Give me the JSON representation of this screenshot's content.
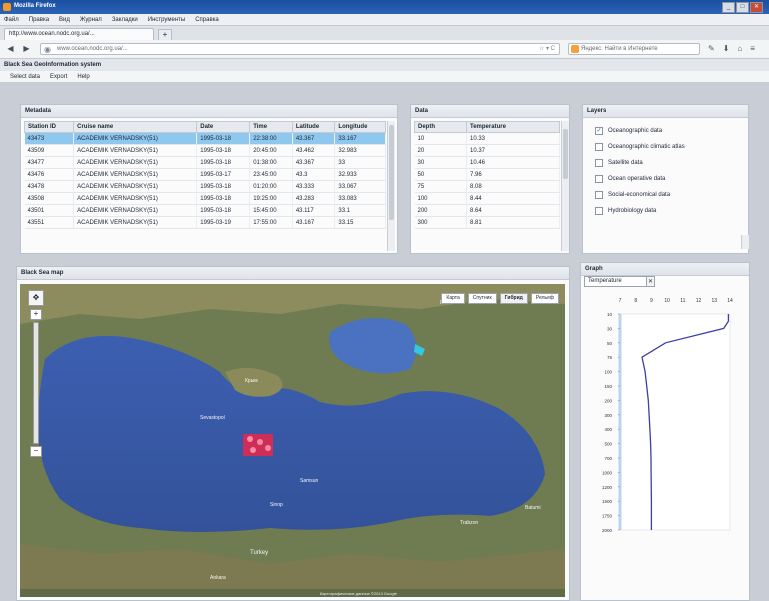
{
  "window": {
    "title": "Mozilla Firefox",
    "minimize": "_",
    "maximize": "□",
    "close": "✕"
  },
  "browser_menu": [
    "Файл",
    "Правка",
    "Вид",
    "Журнал",
    "Закладки",
    "Инструменты",
    "Справка"
  ],
  "tab": {
    "label": "http://www.ocean.nodc.org.ua/...",
    "new_tab": "+"
  },
  "nav": {
    "back": "◀",
    "forward": "▶",
    "url": "www.ocean.nodc.org.ua/...",
    "url_actions": "☆ ▾ C",
    "search_placeholder": "Яндекс: Найти в Интернете",
    "icons": [
      "pencil-icon",
      "download-icon",
      "home-icon",
      "extensions-icon"
    ]
  },
  "app": {
    "title": "Black Sea GeoInformation system",
    "menu": [
      "Select data",
      "Export",
      "Help"
    ]
  },
  "metadata": {
    "header": "Metadata",
    "columns": [
      "Station ID",
      "Cruise name",
      "Date",
      "Time",
      "Latitude",
      "Longitude"
    ],
    "rows": [
      [
        "43473",
        "ACADEMIK VERNADSKY(51)",
        "1995-03-18",
        "22:38:00",
        "43.367",
        "33.167"
      ],
      [
        "43509",
        "ACADEMIK VERNADSKY(51)",
        "1995-03-18",
        "20:45:00",
        "43.462",
        "32.983"
      ],
      [
        "43477",
        "ACADEMIK VERNADSKY(51)",
        "1995-03-18",
        "01:38:00",
        "43.367",
        "33"
      ],
      [
        "43476",
        "ACADEMIK VERNADSKY(51)",
        "1995-03-17",
        "23:45:00",
        "43.3",
        "32.933"
      ],
      [
        "43478",
        "ACADEMIK VERNADSKY(51)",
        "1995-03-18",
        "01:20:00",
        "43.333",
        "33.067"
      ],
      [
        "43508",
        "ACADEMIK VERNADSKY(51)",
        "1995-03-18",
        "19:25:00",
        "43.283",
        "33.083"
      ],
      [
        "43501",
        "ACADEMIK VERNADSKY(51)",
        "1995-03-18",
        "15:45:00",
        "43.117",
        "33.1"
      ],
      [
        "43551",
        "ACADEMIK VERNADSKY(51)",
        "1995-03-19",
        "17:55:00",
        "43.167",
        "33.15"
      ]
    ],
    "selected_row": 0
  },
  "data": {
    "header": "Data",
    "columns": [
      "Depth",
      "Temperature"
    ],
    "rows": [
      [
        "10",
        "10.33"
      ],
      [
        "20",
        "10.37"
      ],
      [
        "30",
        "10.46"
      ],
      [
        "50",
        "7.96"
      ],
      [
        "75",
        "8.08"
      ],
      [
        "100",
        "8.44"
      ],
      [
        "200",
        "8.64"
      ],
      [
        "300",
        "8.81"
      ]
    ]
  },
  "layers": {
    "header": "Layers",
    "items": [
      {
        "label": "Oceanographic data",
        "checked": true
      },
      {
        "label": "Oceanographic climatic atlas",
        "checked": false
      },
      {
        "label": "Satellite data",
        "checked": false
      },
      {
        "label": "Ocean operative data",
        "checked": false
      },
      {
        "label": "Social-economical data",
        "checked": false
      },
      {
        "label": "Hydrobiology data",
        "checked": false
      }
    ]
  },
  "map": {
    "header": "Black Sea map",
    "types": [
      "Карта",
      "Спутник",
      "Гибрид",
      "Рельеф"
    ],
    "active_type": "Гибрид",
    "zoom_in": "+",
    "zoom_out": "−",
    "places": [
      "Sevastopol",
      "Ankara",
      "Turkey",
      "Крым",
      "Sinop",
      "Trabzon",
      "Samsun",
      "Batumi",
      "Rostov"
    ],
    "attribution": "Картографические данные ©2013 Google"
  },
  "graph": {
    "header": "Graph",
    "selector": "Temperature",
    "close": "✕",
    "x_ticks": [
      "7",
      "8",
      "9",
      "10",
      "11",
      "12",
      "13",
      "14"
    ],
    "y_ticks": [
      "10",
      "30",
      "50",
      "75",
      "100",
      "150",
      "200",
      "300",
      "400",
      "500",
      "700",
      "1000",
      "1200",
      "1500",
      "1750",
      "2000"
    ]
  },
  "chart_data": {
    "type": "line",
    "xlabel": "",
    "ylabel": "",
    "xlim": [
      7,
      14
    ],
    "y_reversed": true,
    "series": [
      {
        "x": [
          13.9,
          13.9,
          13.6,
          9.9,
          8.4,
          8.6,
          8.7,
          8.8,
          8.85,
          8.9,
          8.95,
          8.97,
          8.98,
          9.0,
          9.0
        ],
        "y": [
          10,
          20,
          30,
          50,
          75,
          100,
          150,
          200,
          300,
          400,
          500,
          700,
          1000,
          1500,
          2000
        ]
      }
    ]
  },
  "colors": {
    "sea": "#3a5aa8",
    "land": "#6d7a4f",
    "selection": "#8fc8ee",
    "marker": "#e8274a",
    "line": "#3b3fa8"
  }
}
